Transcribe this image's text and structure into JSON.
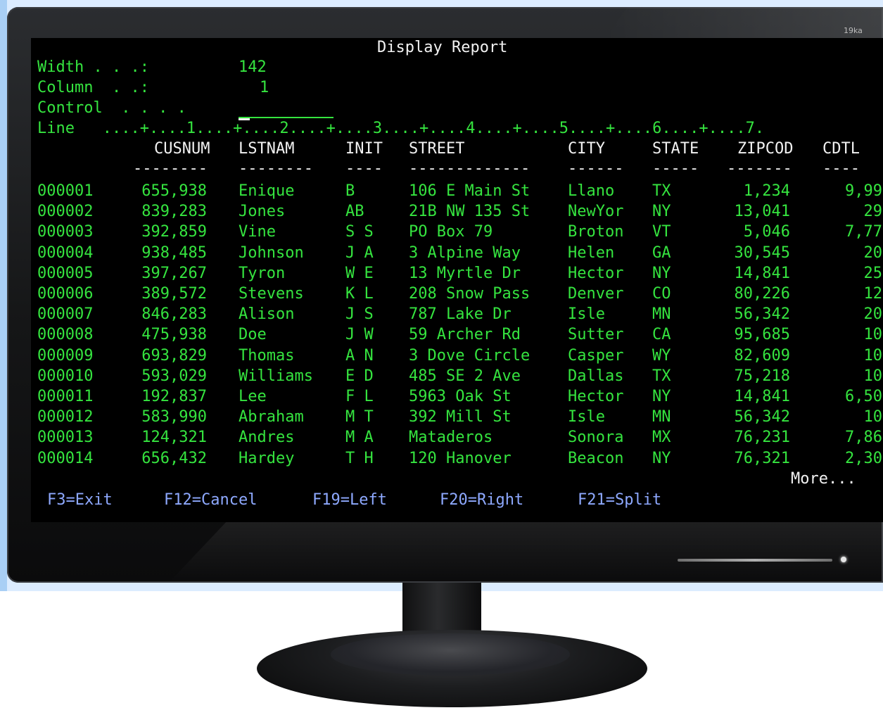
{
  "monitor": {
    "brand": "19ka"
  },
  "screen": {
    "title": "Display Report",
    "fields": {
      "width_label": "Width . . .:",
      "width_value": "142",
      "column_label": "Column  . .:",
      "column_value": "1",
      "control_label": "Control  . . . .",
      "control_value": ""
    },
    "ruler": "Line   ....+....1....+....2....+....3....+....4....+....5....+....6....+....7.",
    "columns": [
      "CUSNUM",
      "LSTNAM",
      "INIT",
      "STREET",
      "CITY",
      "STATE",
      "ZIPCOD",
      "CDTL"
    ],
    "column_dashes": [
      "--------",
      "--------",
      "----",
      "-------------",
      "------",
      "-----",
      "-------",
      "----"
    ],
    "rows": [
      {
        "line": "000001",
        "cusnum": "655,938",
        "lstnam": "Enique",
        "init": "B",
        "street": "106 E Main St",
        "city": "Llano",
        "state": "TX",
        "zipcod": "1,234",
        "cdtl": "9,99"
      },
      {
        "line": "000002",
        "cusnum": "839,283",
        "lstnam": "Jones",
        "init": "AB",
        "street": "21B NW 135 St",
        "city": "NewYor",
        "state": "NY",
        "zipcod": "13,041",
        "cdtl": "29"
      },
      {
        "line": "000003",
        "cusnum": "392,859",
        "lstnam": "Vine",
        "init": "S S",
        "street": "PO Box 79",
        "city": "Broton",
        "state": "VT",
        "zipcod": "5,046",
        "cdtl": "7,77"
      },
      {
        "line": "000004",
        "cusnum": "938,485",
        "lstnam": "Johnson",
        "init": "J A",
        "street": "3 Alpine Way",
        "city": "Helen",
        "state": "GA",
        "zipcod": "30,545",
        "cdtl": "20"
      },
      {
        "line": "000005",
        "cusnum": "397,267",
        "lstnam": "Tyron",
        "init": "W E",
        "street": "13 Myrtle Dr",
        "city": "Hector",
        "state": "NY",
        "zipcod": "14,841",
        "cdtl": "25"
      },
      {
        "line": "000006",
        "cusnum": "389,572",
        "lstnam": "Stevens",
        "init": "K L",
        "street": "208 Snow Pass",
        "city": "Denver",
        "state": "CO",
        "zipcod": "80,226",
        "cdtl": "12"
      },
      {
        "line": "000007",
        "cusnum": "846,283",
        "lstnam": "Alison",
        "init": "J S",
        "street": "787 Lake Dr",
        "city": "Isle",
        "state": "MN",
        "zipcod": "56,342",
        "cdtl": "20"
      },
      {
        "line": "000008",
        "cusnum": "475,938",
        "lstnam": "Doe",
        "init": "J W",
        "street": "59 Archer Rd",
        "city": "Sutter",
        "state": "CA",
        "zipcod": "95,685",
        "cdtl": "10"
      },
      {
        "line": "000009",
        "cusnum": "693,829",
        "lstnam": "Thomas",
        "init": "A N",
        "street": "3 Dove Circle",
        "city": "Casper",
        "state": "WY",
        "zipcod": "82,609",
        "cdtl": "10"
      },
      {
        "line": "000010",
        "cusnum": "593,029",
        "lstnam": "Williams",
        "init": "E D",
        "street": "485 SE 2 Ave",
        "city": "Dallas",
        "state": "TX",
        "zipcod": "75,218",
        "cdtl": "10"
      },
      {
        "line": "000011",
        "cusnum": "192,837",
        "lstnam": "Lee",
        "init": "F L",
        "street": "5963 Oak St",
        "city": "Hector",
        "state": "NY",
        "zipcod": "14,841",
        "cdtl": "6,50"
      },
      {
        "line": "000012",
        "cusnum": "583,990",
        "lstnam": "Abraham",
        "init": "M T",
        "street": "392 Mill St",
        "city": "Isle",
        "state": "MN",
        "zipcod": "56,342",
        "cdtl": "10"
      },
      {
        "line": "000013",
        "cusnum": "124,321",
        "lstnam": "Andres",
        "init": "M A",
        "street": "Mataderos",
        "city": "Sonora",
        "state": "MX",
        "zipcod": "76,231",
        "cdtl": "7,86"
      },
      {
        "line": "000014",
        "cusnum": "656,432",
        "lstnam": "Hardey",
        "init": "T H",
        "street": "120 Hanover",
        "city": "Beacon",
        "state": "NY",
        "zipcod": "76,321",
        "cdtl": "2,30"
      }
    ],
    "more": "More...",
    "function_keys": [
      "F3=Exit",
      "F12=Cancel",
      "F19=Left",
      "F20=Right",
      "F21=Split"
    ]
  }
}
